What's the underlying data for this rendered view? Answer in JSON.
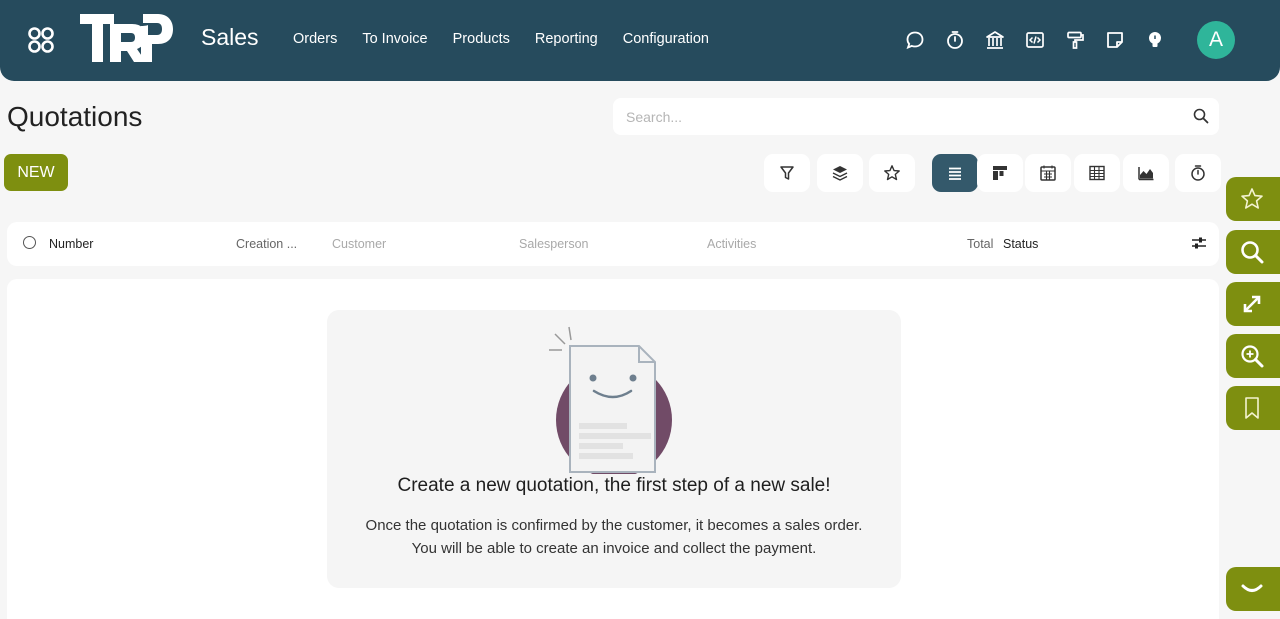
{
  "navbar": {
    "app_title": "Sales",
    "menu": [
      "Orders",
      "To Invoice",
      "Products",
      "Reporting",
      "Configuration"
    ],
    "system_icons": [
      "chat-icon",
      "timer-icon",
      "bank-icon",
      "code-icon",
      "paint-roller-icon",
      "note-icon",
      "lightbulb-icon"
    ],
    "avatar_letter": "A",
    "colors": {
      "bar": "#264b5d",
      "avatar": "#2fb59a"
    }
  },
  "control_panel": {
    "title": "Quotations",
    "search_placeholder": "Search...",
    "new_label": "NEW",
    "toolbar_left": [
      "filter-icon",
      "layers-icon",
      "star-icon"
    ],
    "views": [
      "list-view-icon",
      "kanban-view-icon",
      "calendar-view-icon",
      "pivot-view-icon",
      "graph-view-icon",
      "activity-view-icon"
    ],
    "active_view": "list-view-icon",
    "accent": "#7e8f10"
  },
  "list": {
    "columns": {
      "number": "Number",
      "creation": "Creation ...",
      "customer": "Customer",
      "salesperson": "Salesperson",
      "activities": "Activities",
      "total": "Total",
      "status": "Status"
    }
  },
  "empty_state": {
    "title": "Create a new quotation, the first step of a new sale!",
    "line1": "Once the quotation is confirmed by the customer, it becomes a sales order.",
    "line2": "You will be able to create an invoice and collect the payment."
  },
  "side_tabs": [
    "star-icon",
    "search-icon",
    "expand-icon",
    "zoom-in-icon",
    "bookmark-icon",
    "chevron-down-icon"
  ]
}
